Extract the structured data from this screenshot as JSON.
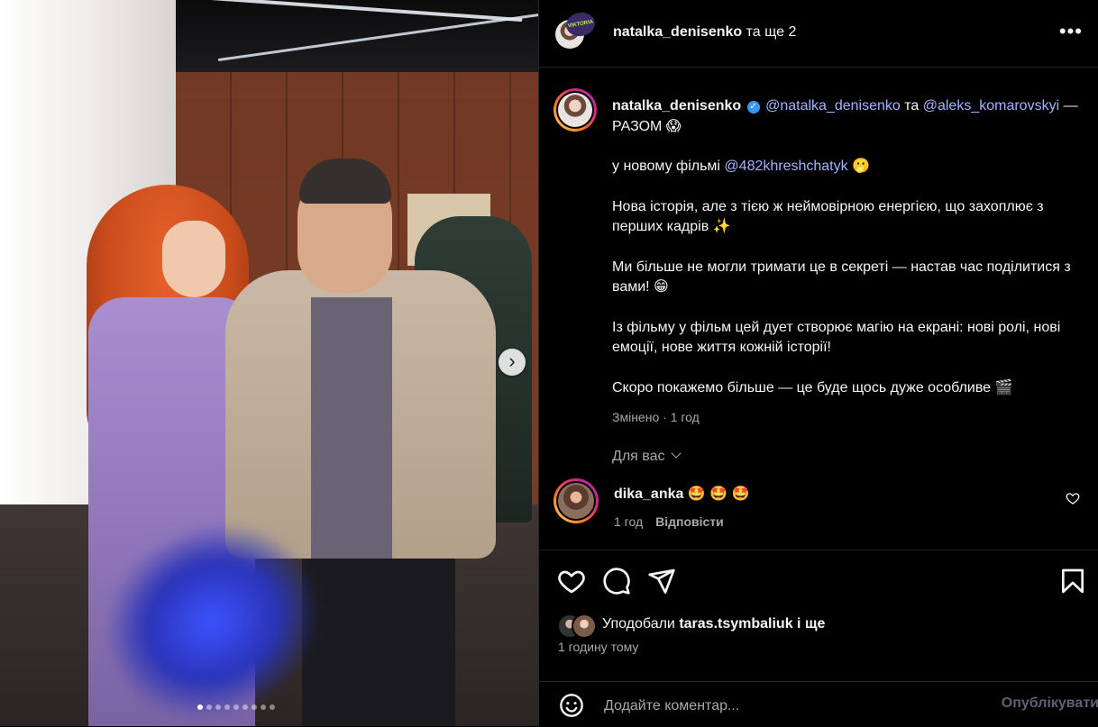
{
  "header": {
    "username": "natalka_denisenko",
    "suffix": "та ще 2",
    "badge_text": "VIKTORIA",
    "more_icon": "more-horizontal-icon"
  },
  "carousel": {
    "total": 9,
    "active_index": 0,
    "next_icon": "chevron-right-icon"
  },
  "caption": {
    "username": "natalka_denisenko",
    "mention1": "@natalka_denisenko",
    "and": "та",
    "mention2": "@aleks_komarovskyi",
    "line1_tail": "— РАЗОМ 😱",
    "p2_text": "у новому фільмі",
    "p2_mention": "@482khreshchatyk",
    "p2_emoji": "🫢",
    "p3": "Нова історія, але з тією ж неймовірною енергією, що захоплює з перших кадрів ✨",
    "p4": "Ми більше не могли тримати це в секреті — настав час поділитися з вами! 😁",
    "p5": "Із фільму у фільм цей дует створює магію на екрані: нові ролі, нові емоції, нове життя кожній історії!",
    "p6": "Скоро покажемо більше — це буде щось дуже особливе 🎬",
    "edited": "Змінено",
    "dot": "·",
    "age": "1 год"
  },
  "for_you": "Для вас",
  "comment": {
    "username": "dika_anka",
    "text": "🤩 🤩 🤩",
    "age": "1 год",
    "reply": "Відповісти"
  },
  "actions": {
    "like_icon": "heart-icon",
    "comment_icon": "comment-icon",
    "share_icon": "send-icon",
    "save_icon": "bookmark-icon"
  },
  "likes": {
    "prefix": "Уподобали",
    "user": "taras.tsymbaliuk",
    "suffix": "і ще"
  },
  "time_ago": "1 годину тому",
  "add_comment": {
    "placeholder": "Додайте коментар...",
    "publish": "Опублікувати"
  },
  "colors": {
    "background": "#000000",
    "mention": "#a2b4ff",
    "muted": "#a8a8a8",
    "publish_disabled": "#5c6275",
    "verified": "#3897f0"
  }
}
